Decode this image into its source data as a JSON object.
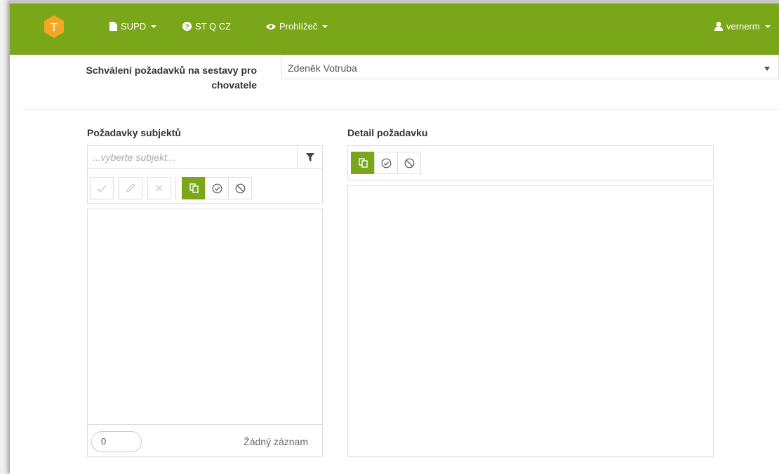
{
  "nav": {
    "supd_label": "SUPD",
    "stq_label": "ST Q CZ",
    "viewer_label": "Prohlížeč",
    "user_label": "vernerm",
    "logo_letter": "T"
  },
  "header": {
    "title": "Schválení požadavků na sestavy pro chovatele",
    "select_value": "Zdeněk Votruba"
  },
  "left_panel": {
    "title": "Požadavky subjektů",
    "search_placeholder": "...vyberte subjekt...",
    "pager_value": "0",
    "status_text": "Žádný záznam"
  },
  "right_panel": {
    "title": "Detail požadavku"
  },
  "colors": {
    "brand_green": "#7aa61a",
    "logo_orange": "#f5a623"
  },
  "icons": {
    "supd": "file-icon",
    "stq": "question-circle-icon",
    "viewer": "eye-icon",
    "user": "user-icon",
    "filter": "filter-icon",
    "confirm": "check-icon",
    "edit": "pencil-icon",
    "delete": "x-icon",
    "copy": "copy-icon",
    "approve": "check-circle-icon",
    "reject": "ban-icon"
  }
}
